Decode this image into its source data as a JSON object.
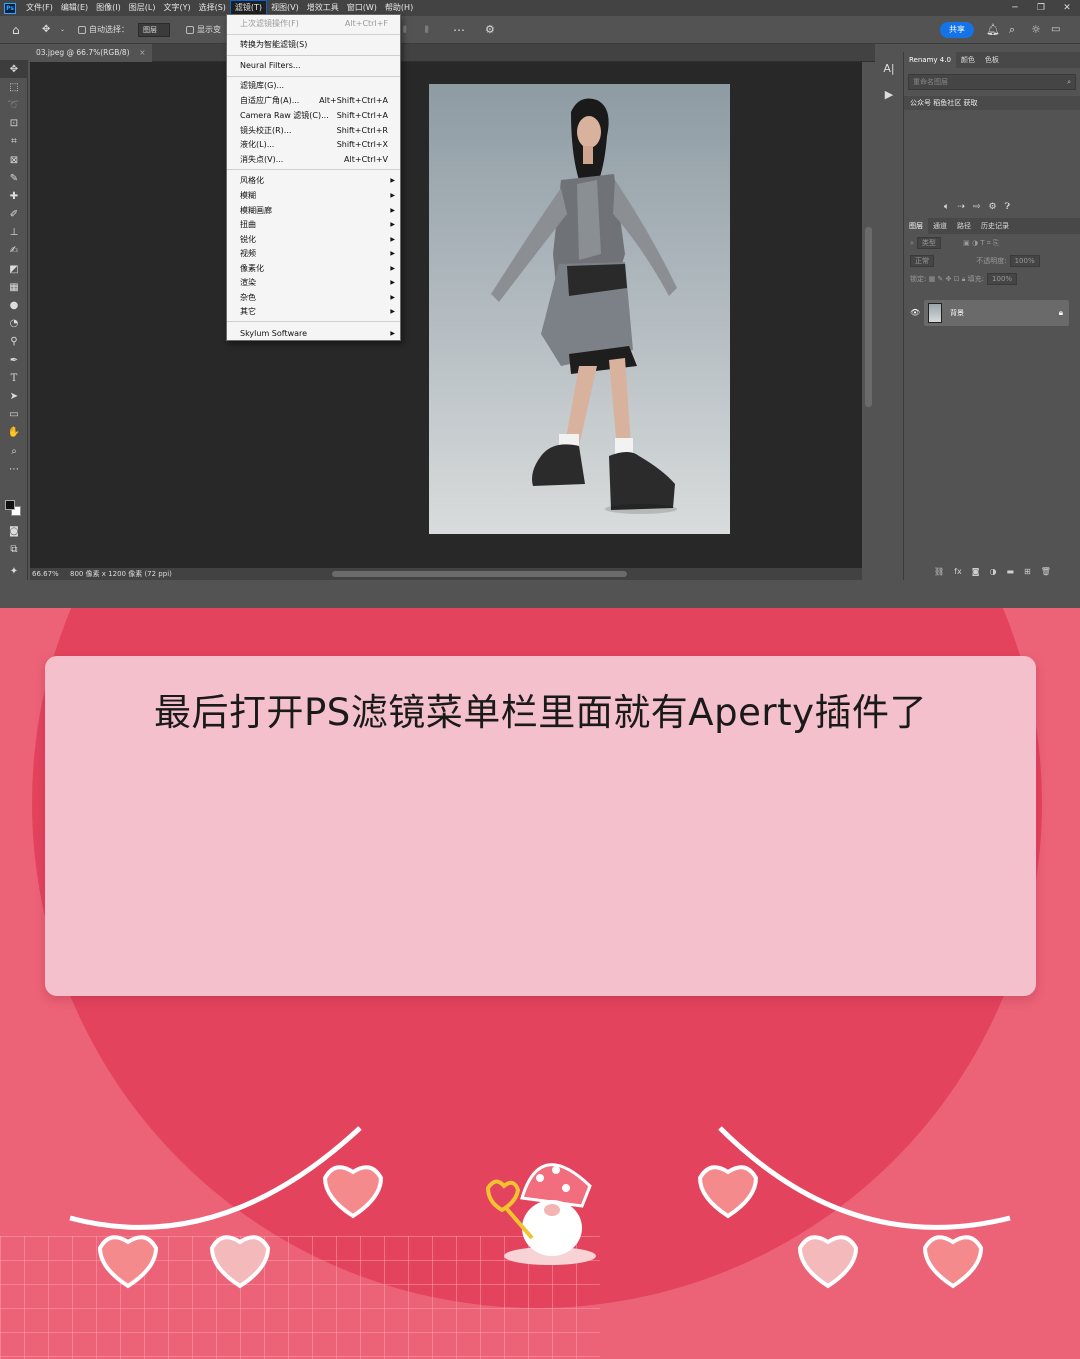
{
  "menubar": {
    "logo": "Ps",
    "items": [
      "文件(F)",
      "编辑(E)",
      "图像(I)",
      "图层(L)",
      "文字(Y)",
      "选择(S)",
      "滤镜(T)",
      "视图(V)",
      "增效工具",
      "窗口(W)",
      "帮助(H)"
    ],
    "active_index": 6
  },
  "options_bar": {
    "auto_select_label": "自动选择：",
    "auto_select_value": "图层",
    "show_transform_label": "显示变",
    "share_label": "共享"
  },
  "document": {
    "tab_label": "03.jpeg @ 66.7%(RGB/8)",
    "zoom": "66.67%",
    "dimensions": "800 像素 x 1200 像素 (72 ppi)"
  },
  "filter_menu": {
    "rows": [
      {
        "label": "上次滤镜操作(F)",
        "shortcut": "Alt+Ctrl+F",
        "disabled": true
      },
      {
        "label": "转换为智能滤镜(S)",
        "shortcut": ""
      },
      {
        "label": "Neural Filters...",
        "shortcut": ""
      },
      {
        "label": "滤镜库(G)...",
        "shortcut": ""
      },
      {
        "label": "自适应广角(A)...",
        "shortcut": "Alt+Shift+Ctrl+A"
      },
      {
        "label": "Camera Raw 滤镜(C)...",
        "shortcut": "Shift+Ctrl+A"
      },
      {
        "label": "镜头校正(R)...",
        "shortcut": "Shift+Ctrl+R"
      },
      {
        "label": "液化(L)...",
        "shortcut": "Shift+Ctrl+X"
      },
      {
        "label": "消失点(V)...",
        "shortcut": "Alt+Ctrl+V"
      },
      {
        "label": "风格化",
        "submenu": true
      },
      {
        "label": "模糊",
        "submenu": true
      },
      {
        "label": "模糊画廊",
        "submenu": true
      },
      {
        "label": "扭曲",
        "submenu": true
      },
      {
        "label": "锐化",
        "submenu": true
      },
      {
        "label": "视频",
        "submenu": true
      },
      {
        "label": "像素化",
        "submenu": true
      },
      {
        "label": "渲染",
        "submenu": true
      },
      {
        "label": "杂色",
        "submenu": true
      },
      {
        "label": "其它",
        "submenu": true
      },
      {
        "label": "Skylum Software",
        "submenu": true
      }
    ]
  },
  "right_panel": {
    "tabs": [
      "Renamy 4.0",
      "颜色",
      "色板"
    ],
    "search_placeholder": "重命名图层",
    "renamy_item": "公众号 稻鱼社区 获取",
    "layer_tabs": [
      "图层",
      "通道",
      "路径",
      "历史记录"
    ],
    "filter_kind": "类型",
    "blend_mode": "正常",
    "opacity_label": "不透明度:",
    "opacity_value": "100%",
    "lock_label": "锁定:",
    "fill_label": "填充:",
    "fill_value": "100%",
    "layer_name": "背景"
  },
  "caption": {
    "text": "最后打开PS滤镜菜单栏里面就有Aperty插件了"
  },
  "colors": {
    "ps_bg": "#535353",
    "pink_bg": "#ec6277",
    "circle": "#e3435d",
    "card": "#f4c0cb",
    "accent_blue": "#1473e6"
  }
}
